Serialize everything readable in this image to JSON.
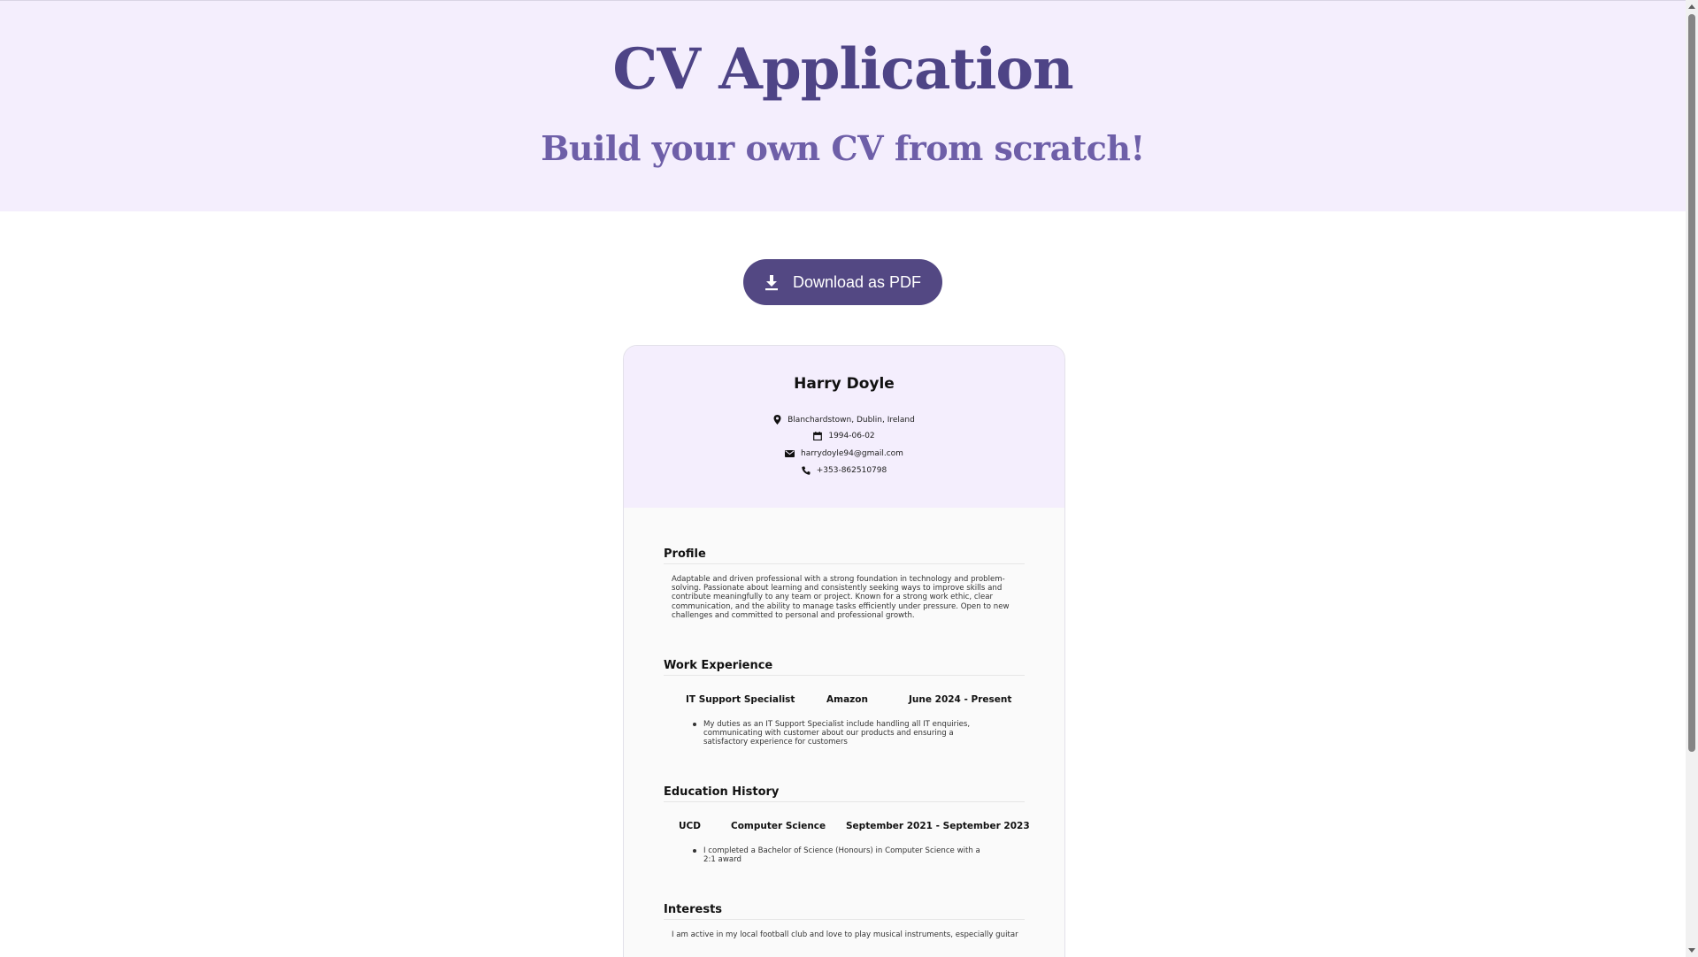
{
  "hero": {
    "title": "CV Application",
    "subtitle": "Build your own CV from scratch!"
  },
  "actions": {
    "download_label": "Download as PDF",
    "download_icon": "download-icon"
  },
  "cv": {
    "name": "Harry Doyle",
    "contact": {
      "location": "Blanchardstown, Dublin, Ireland",
      "dob": "1994-06-02",
      "email": "harrydoyle94@gmail.com",
      "phone": "+353-862510798"
    },
    "profile": {
      "title": "Profile",
      "text": "Adaptable and driven professional with a strong foundation in technology and problem-solving. Passionate about learning and consistently seeking ways to improve skills and contribute meaningfully to any team or project. Known for a strong work ethic, clear communication, and the ability to manage tasks efficiently under pressure. Open to new challenges and committed to personal and professional growth."
    },
    "work": {
      "title": "Work Experience",
      "items": [
        {
          "role": "IT Support Specialist",
          "company": "Amazon",
          "dates": "June 2024 - Present",
          "bullets": [
            "My duties as an IT Support Specialist include handling all IT enquiries, communicating with customer about our products and ensuring a satisfactory experience for customers"
          ]
        }
      ]
    },
    "education": {
      "title": "Education History",
      "items": [
        {
          "school": "UCD",
          "course": "Computer Science",
          "dates": "September 2021 - September 2023",
          "bullets": [
            "I completed a Bachelor of Science (Honours) in Computer Science with a 2:1 award"
          ]
        }
      ]
    },
    "interests": {
      "title": "Interests",
      "text": "I am active in my local football club and love to play musical instruments, especially guitar"
    }
  },
  "colors": {
    "hero_bg": "#f4eefd",
    "title": "#4e4486",
    "subtitle": "#6e5fa8",
    "button": "#534883"
  }
}
